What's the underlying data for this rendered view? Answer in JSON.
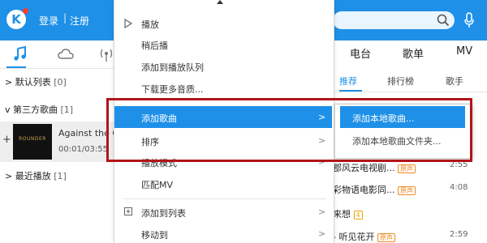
{
  "header": {
    "logo_letter": "K",
    "login": "登录",
    "separator": "|",
    "register": "注册"
  },
  "colors": {
    "brand_blue": "#1e90e8",
    "highlight_red": "#b2141a",
    "badge_orange": "#f08a24"
  },
  "left_panel": {
    "groups": [
      {
        "chevron": ">",
        "label": "默认列表",
        "count": "[0]"
      },
      {
        "chevron": "v",
        "label": "第三方歌曲",
        "count": "[1]"
      },
      {
        "chevron": ">",
        "label": "最近播放",
        "count": "[1]"
      }
    ],
    "song": {
      "add_symbol": "+",
      "cover_text": "ROUNDER",
      "title": "Against the G",
      "time": "00:01/03:55"
    }
  },
  "right_panel": {
    "top_tabs": [
      "电台",
      "歌单",
      "MV"
    ],
    "sub_tabs": [
      "推荐",
      "排行榜",
      "歌手"
    ],
    "rows": [
      {
        "text": "郡风云电视剧...",
        "badge": "原声",
        "time": "2:55"
      },
      {
        "text": "彩物语电影同...",
        "badge": "原声",
        "time": "4:08"
      },
      {
        "text": "来想",
        "badge": "4",
        "time": ""
      },
      {
        "text": "- 听见花开",
        "badge": "原声",
        "time": "2:59"
      }
    ]
  },
  "context_menu": {
    "items": [
      {
        "label": "播放"
      },
      {
        "label": "稍后播"
      },
      {
        "label": "添加到播放队列"
      },
      {
        "label": "下载更多音质..."
      },
      {
        "label": "添加歌曲",
        "arrow": ">"
      },
      {
        "label": "排序",
        "arrow": ">"
      },
      {
        "label": "播放模式",
        "arrow": ">"
      },
      {
        "label": "匹配MV"
      },
      {
        "label": "添加到列表",
        "arrow": ">"
      },
      {
        "label": "移动到",
        "arrow": ">"
      }
    ],
    "submenu": [
      {
        "label": "添加本地歌曲..."
      },
      {
        "label": "添加本地歌曲文件夹..."
      }
    ]
  }
}
